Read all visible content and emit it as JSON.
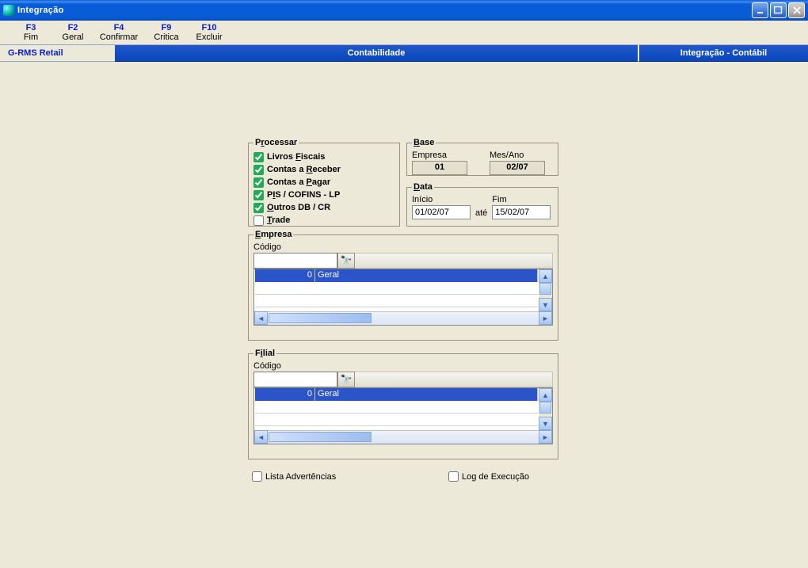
{
  "window": {
    "title": "Integração"
  },
  "menu": {
    "f3_key": "F3",
    "f3_label": "Fim",
    "f2_key": "F2",
    "f2_label": "Geral",
    "f4_key": "F4",
    "f4_label": "Confirmar",
    "f9_key": "F9",
    "f9_label": "Critica",
    "f10_key": "F10",
    "f10_label": "Excluir"
  },
  "bar": {
    "left": "G-RMS Retail",
    "mid": "Contabilidade",
    "right": "Integração - Contábil"
  },
  "processar": {
    "legend_pre": "P",
    "legend_ul": "r",
    "legend_post": "ocessar",
    "items": [
      {
        "checked": true,
        "pre": "Livros ",
        "u": "F",
        "post": "iscais"
      },
      {
        "checked": true,
        "pre": "Contas a ",
        "u": "R",
        "post": "eceber"
      },
      {
        "checked": true,
        "pre": "Contas a ",
        "u": "P",
        "post": "agar"
      },
      {
        "checked": true,
        "pre": "P",
        "u": "I",
        "post": "S / COFINS - LP"
      },
      {
        "checked": true,
        "pre": "",
        "u": "O",
        "post": "utros DB / CR"
      },
      {
        "checked": false,
        "pre": "",
        "u": "T",
        "post": "rade"
      }
    ]
  },
  "base": {
    "legend_ul": "B",
    "legend_post": "ase",
    "empresa_label": "Empresa",
    "empresa_value": "01",
    "mesano_label": "Mes/Ano",
    "mesano_value": "02/07"
  },
  "data": {
    "legend_ul": "D",
    "legend_post": "ata",
    "inicio_label": "Início",
    "inicio_value": "01/02/07",
    "ate_label": "até",
    "fim_label": "Fim",
    "fim_value": "15/02/07"
  },
  "empresa": {
    "legend_ul": "E",
    "legend_post": "mpresa",
    "codigo_label": "Código",
    "row_code": "0",
    "row_desc": "Geral"
  },
  "filial": {
    "legend_pre": "F",
    "legend_ul": "i",
    "legend_post": "lial",
    "codigo_label": "Código",
    "row_code": "0",
    "row_desc": "Geral"
  },
  "footer": {
    "lista_label": "Lista Advertências",
    "log_label": "Log de Execução"
  }
}
